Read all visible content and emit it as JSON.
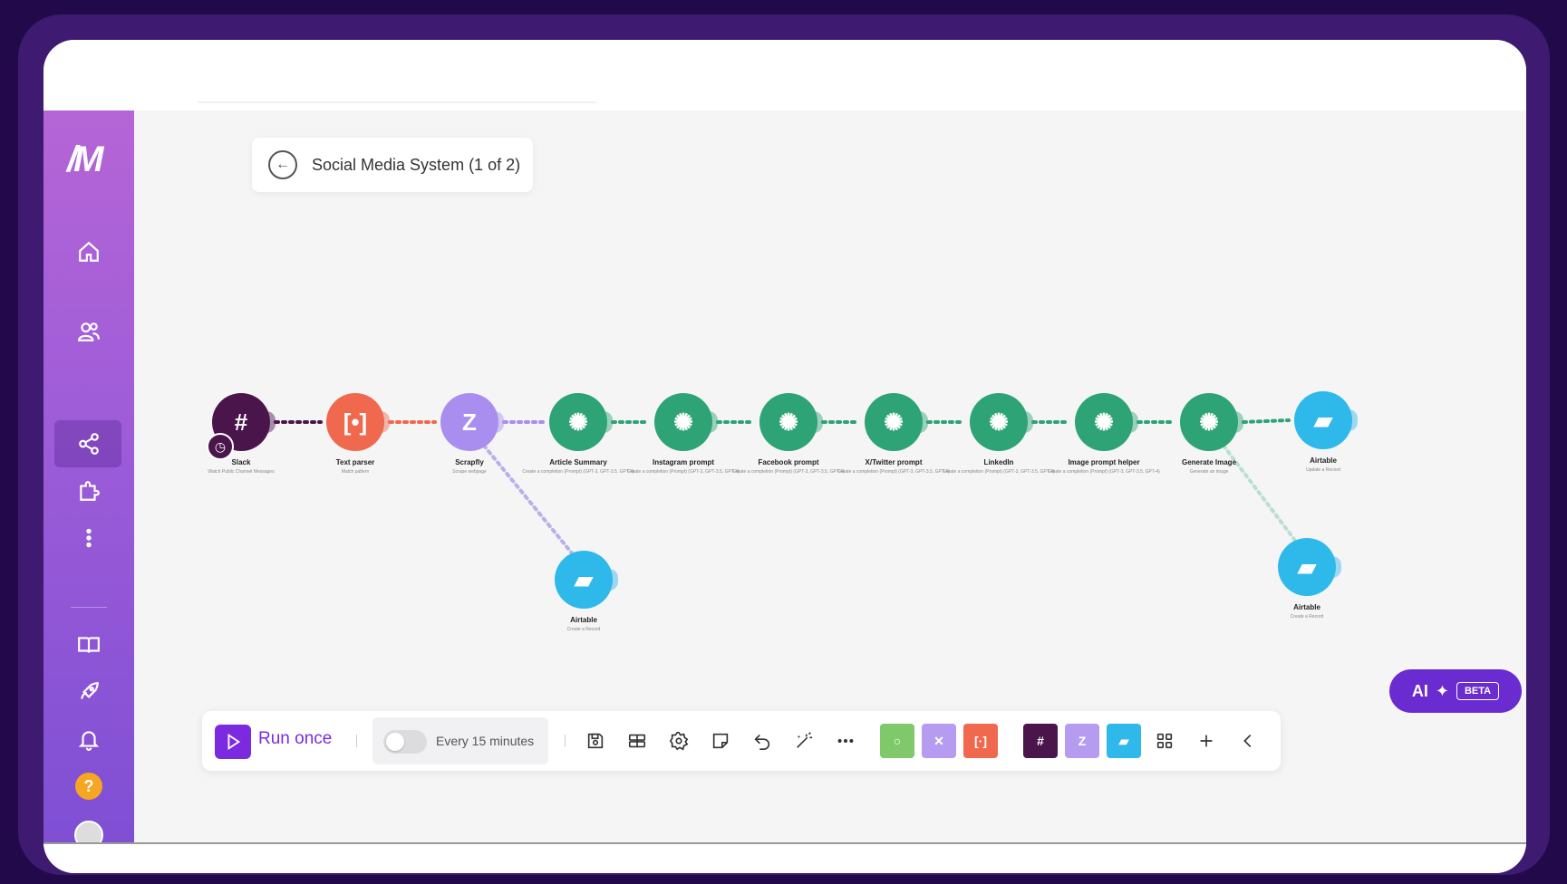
{
  "scenario": {
    "title": "Social Media System (1 of 2)"
  },
  "sidebar": {
    "logo": "/M",
    "items": [
      "home-icon",
      "users-icon",
      "share-icon",
      "puzzle-icon",
      "more-icon",
      "book-icon",
      "rocket-icon",
      "bell-icon",
      "help-icon",
      "avatar"
    ]
  },
  "nodes": [
    {
      "label": "Slack",
      "sub": "Watch Public Channel Messages",
      "color": "#4a154b",
      "glyph": "#"
    },
    {
      "label": "Text parser",
      "sub": "Match pattern",
      "color": "#f0684d",
      "glyph": "[•]"
    },
    {
      "label": "Scrapfly",
      "sub": "Scrape webpage",
      "color": "#a98ef0",
      "glyph": "Z"
    },
    {
      "label": "Article Summary",
      "sub": "Create a completion (Prompt) (GPT-3, GPT-3.5, GPT-4)",
      "color": "#2da376",
      "glyph": "✺"
    },
    {
      "label": "Instagram prompt",
      "sub": "Create a completion (Prompt) (GPT-3, GPT-3.5, GPT-4)",
      "color": "#2da376",
      "glyph": "✺"
    },
    {
      "label": "Facebook prompt",
      "sub": "Create a completion (Prompt) (GPT-3, GPT-3.5, GPT-4)",
      "color": "#2da376",
      "glyph": "✺"
    },
    {
      "label": "X/Twitter prompt",
      "sub": "Create a completion (Prompt) (GPT-3, GPT-3.5, GPT-4)",
      "color": "#2da376",
      "glyph": "✺"
    },
    {
      "label": "LinkedIn",
      "sub": "Create a completion (Prompt) (GPT-3, GPT-3.5, GPT-4)",
      "color": "#2da376",
      "glyph": "✺"
    },
    {
      "label": "Image prompt helper",
      "sub": "Create a completion (Prompt) (GPT-3, GPT-3.5, GPT-4)",
      "color": "#2da376",
      "glyph": "✺"
    },
    {
      "label": "Generate Image",
      "sub": "Generate an image",
      "color": "#2da376",
      "glyph": "✺"
    },
    {
      "label": "Airtable",
      "sub": "Update a Record",
      "color": "#2fb8ea",
      "glyph": "▰"
    },
    {
      "label": "Airtable",
      "sub": "Create a Record",
      "color": "#2fb8ea",
      "glyph": "▰"
    },
    {
      "label": "Airtable",
      "sub": "Create a Record",
      "color": "#2fb8ea",
      "glyph": "▰"
    }
  ],
  "toolbar": {
    "run_label": "Run once",
    "schedule_label": "Every 15 minutes",
    "tools": [
      "save-icon",
      "scenario-settings-icon",
      "gear-icon",
      "notes-icon",
      "undo-icon",
      "magic-wand-icon",
      "more-horizontal-icon"
    ],
    "chips": [
      {
        "name": "flow-control-chip",
        "color": "#7fc96a",
        "glyph": "○"
      },
      {
        "name": "tools-chip",
        "color": "#b59cf0",
        "glyph": "✕"
      },
      {
        "name": "text-parser-chip",
        "color": "#f0684d",
        "glyph": "[·]"
      },
      {
        "name": "slack-chip",
        "color": "#4a154b",
        "glyph": "#"
      },
      {
        "name": "scrapfly-chip",
        "color": "#b59cf0",
        "glyph": "Z"
      },
      {
        "name": "airtable-chip",
        "color": "#2fb8ea",
        "glyph": "▰"
      }
    ]
  },
  "ai_button": {
    "label": "AI",
    "badge": "BETA"
  }
}
